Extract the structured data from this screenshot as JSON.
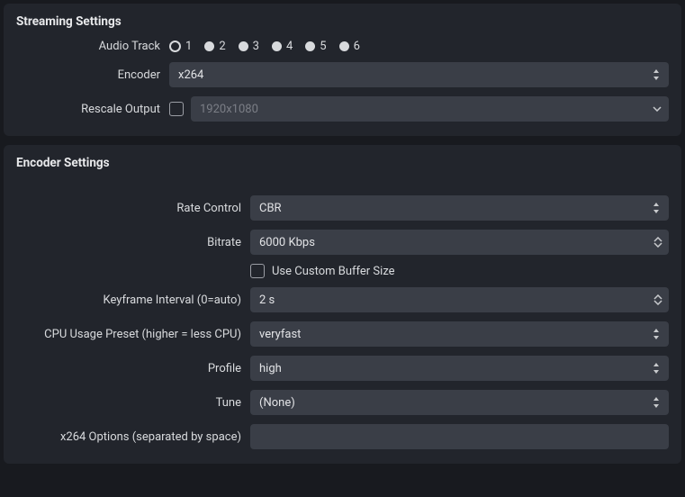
{
  "streaming": {
    "title": "Streaming Settings",
    "audio_track_label": "Audio Track",
    "audio_tracks": [
      "1",
      "2",
      "3",
      "4",
      "5",
      "6"
    ],
    "audio_track_selected": 0,
    "encoder_label": "Encoder",
    "encoder_value": "x264",
    "rescale_label": "Rescale Output",
    "rescale_checked": false,
    "rescale_placeholder": "1920x1080"
  },
  "encoder": {
    "title": "Encoder Settings",
    "rate_control_label": "Rate Control",
    "rate_control_value": "CBR",
    "bitrate_label": "Bitrate",
    "bitrate_value": "6000 Kbps",
    "custom_buffer_checked": false,
    "custom_buffer_label": "Use Custom Buffer Size",
    "keyframe_label": "Keyframe Interval (0=auto)",
    "keyframe_value": "2 s",
    "cpu_preset_label": "CPU Usage Preset (higher = less CPU)",
    "cpu_preset_value": "veryfast",
    "profile_label": "Profile",
    "profile_value": "high",
    "tune_label": "Tune",
    "tune_value": "(None)",
    "x264_opts_label": "x264 Options (separated by space)",
    "x264_opts_value": ""
  }
}
